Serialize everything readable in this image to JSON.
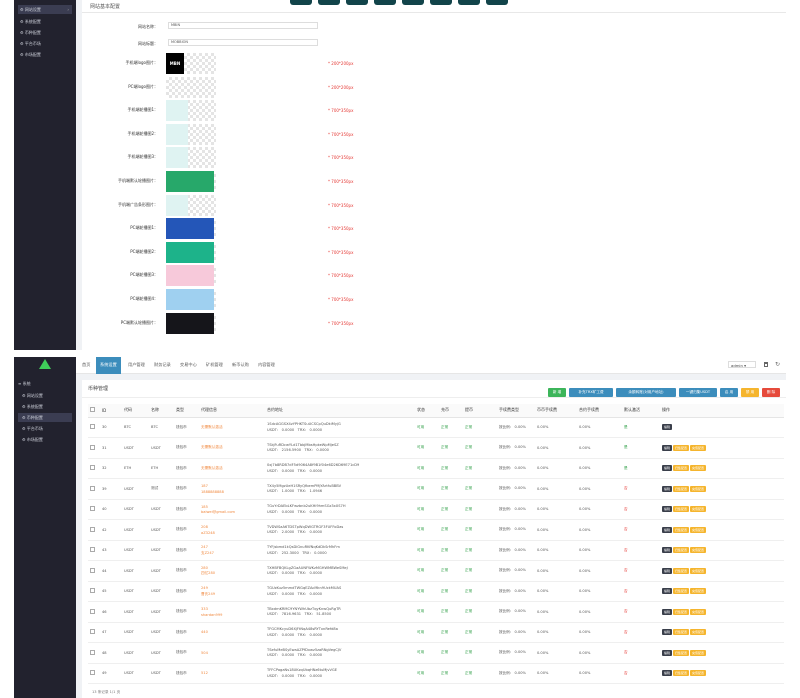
{
  "top_screen": {
    "sidebar": {
      "items": [
        {
          "label": "网站设置",
          "active": true
        },
        {
          "label": "系统配置"
        },
        {
          "label": "币种配置"
        },
        {
          "label": "平台币场"
        },
        {
          "label": "市场配置"
        }
      ]
    },
    "panel_title": "网站基本配置",
    "fields": [
      {
        "label": "网站名称：",
        "value": "MBIN"
      },
      {
        "label": "网站标题：",
        "value": "MOBBION"
      }
    ],
    "image_fields": [
      {
        "label": "手机端logo图片：",
        "hint": "* 200*200px",
        "thumb": "logo"
      },
      {
        "label": "PC端logo图片：",
        "hint": "* 200*200px",
        "thumb": "empty"
      },
      {
        "label": "手机端轮播图1：",
        "hint": "* 700*350px",
        "thumb": "banner-light"
      },
      {
        "label": "手机端轮播图2：",
        "hint": "* 700*350px",
        "thumb": "banner-light"
      },
      {
        "label": "手机端轮播图3：",
        "hint": "* 700*350px",
        "thumb": "banner-light"
      },
      {
        "label": "手机端默认轮播图片：",
        "hint": "* 700*350px",
        "thumb": "green"
      },
      {
        "label": "手机端广告条形图片：",
        "hint": "* 700*350px",
        "thumb": "banner-light"
      },
      {
        "label": "PC端轮播图1：",
        "hint": "* 700*350px",
        "thumb": "blue"
      },
      {
        "label": "PC端轮播图2：",
        "hint": "* 700*350px",
        "thumb": "teal"
      },
      {
        "label": "PC端轮播图3：",
        "hint": "* 700*350px",
        "thumb": "pink"
      },
      {
        "label": "PC端轮播图4：",
        "hint": "* 700*350px",
        "thumb": "lightblue"
      },
      {
        "label": "PC端默认轮播图片：",
        "hint": "* 700*350px",
        "thumb": "dark"
      }
    ],
    "logo_text": "MBN"
  },
  "bottom_screen": {
    "sidebar": {
      "section": "系统",
      "items": [
        {
          "label": "网站设置"
        },
        {
          "label": "系统配置"
        },
        {
          "label": "币种配置",
          "active": true
        },
        {
          "label": "平台币场"
        },
        {
          "label": "市场配置"
        }
      ]
    },
    "nav_tabs": [
      "首页",
      "系统设置",
      "用户管理",
      "财务记录",
      "交易中心",
      "矿机管理",
      "新币认购",
      "内容管理"
    ],
    "active_tab": 1,
    "admin_label": "admin ▾",
    "card_title": "币种管理",
    "buttons": [
      {
        "label": "新 增",
        "color": "#3cb55a"
      },
      {
        "label": "补充TRX矿工费",
        "color": "#3c8dbc"
      },
      {
        "label": "余额转账(对用户地址)",
        "color": "#3c8dbc"
      },
      {
        "label": "一键归集USDT",
        "color": "#3c8dbc"
      },
      {
        "label": "启 用",
        "color": "#3c8dbc"
      },
      {
        "label": "禁 用",
        "color": "#f5b52e"
      },
      {
        "label": "删 除",
        "color": "#e64a3b"
      }
    ],
    "table": {
      "headers": [
        "",
        "ID",
        "代码",
        "名称",
        "类型",
        "代理信息",
        "合约地址",
        "状态",
        "充币",
        "提币",
        "手续费类型",
        "",
        "币币手续费",
        "合约手续费",
        "默认激活",
        "操作"
      ],
      "rows": [
        {
          "id": "30",
          "code": "BTC",
          "name": "BTC",
          "type": "钱包币",
          "agent": "无需默认激活",
          "agent2": "",
          "addr": "1SdcAGGSX4zYPHKTSuUCSCpQuDkiMyjG",
          "usdt": "USDT： 0.0000",
          "trx": "TRX： 0.0000",
          "status": "可用",
          "deposit": "正常",
          "withdraw": "正常",
          "fee": "按比例： 0.00%",
          "coinfee": "0.00%",
          "contractfee": "0.00%",
          "default": "是",
          "default_color": "green",
          "actions": [
            "编辑"
          ]
        },
        {
          "id": "31",
          "code": "USDT",
          "name": "USDT",
          "type": "钱包币",
          "agent": "无需默认激活",
          "agent2": "",
          "addr": "TSkjFuRDcwYLd1TbbjMbsHpkeWpMjeSZ",
          "usdt": "USDT： 2156.5900",
          "trx": "TRX： 0.0000",
          "status": "可用",
          "deposit": "正常",
          "withdraw": "正常",
          "fee": "按比例： 0.00%",
          "coinfee": "0.00%",
          "contractfee": "0.00%",
          "default": "是",
          "default_color": "green",
          "actions": [
            "编辑",
            "归集配置",
            "充值配置"
          ]
        },
        {
          "id": "32",
          "code": "ETH",
          "name": "ETH",
          "type": "钱包币",
          "agent": "无需默认激活",
          "agent2": "",
          "addr": "0xj7b8RDB7dF5d9064A8f9B1f04e6D26D69E71cD9",
          "usdt": "USDT： 0.0000",
          "trx": "TRX： 0.0000",
          "status": "可用",
          "deposit": "正常",
          "withdraw": "正常",
          "fee": "按比例： 0.00%",
          "coinfee": "0.00%",
          "contractfee": "0.00%",
          "default": "是",
          "default_color": "green",
          "actions": [
            "编辑",
            "归集配置",
            "充值配置"
          ]
        },
        {
          "id": "39",
          "code": "USDT",
          "name": "测试",
          "type": "钱包币",
          "agent": "187",
          "agent2": "1888888888",
          "addr": "TX4y5MgzUeH1SRyQfbemPMjYArtfuBBBV",
          "usdt": "USDT： 1.0000",
          "trx": "TRX： 1.0946",
          "status": "可用",
          "deposit": "正常",
          "withdraw": "正常",
          "fee": "按比例： 0.00%",
          "coinfee": "0.00%",
          "contractfee": "0.00%",
          "default": "否",
          "default_color": "red",
          "actions": [
            "编辑",
            "归集配置",
            "充值配置"
          ]
        },
        {
          "id": "40",
          "code": "USDT",
          "name": "USDT",
          "type": "钱包币",
          "agent": "185",
          "agent2": "baiwei@gmail.com",
          "addr": "TGuYrDAEbLKFwzbnb2uKHi9hmSGz3xXS7H",
          "usdt": "USDT： 0.0000",
          "trx": "TRX： 0.0000",
          "status": "可用",
          "deposit": "正常",
          "withdraw": "正常",
          "fee": "按比例： 0.00%",
          "coinfee": "0.00%",
          "contractfee": "0.00%",
          "default": "否",
          "default_color": "red",
          "actions": [
            "编辑",
            "归集配置",
            "充值配置"
          ]
        },
        {
          "id": "42",
          "code": "USDT",
          "name": "USDT",
          "type": "钱包币",
          "agent": "208",
          "agent2": "aZ3248",
          "addr": "TVDWSaA6TDSTpWqDWGTRGF3FUFFoDas",
          "usdt": "USDT： 2.0000",
          "trx": "TRX： 0.0000",
          "status": "可用",
          "deposit": "正常",
          "withdraw": "正常",
          "fee": "按比例： 0.00%",
          "coinfee": "0.00%",
          "contractfee": "0.00%",
          "default": "否",
          "default_color": "red",
          "actions": [
            "编辑",
            "归集配置",
            "充值配置"
          ]
        },
        {
          "id": "43",
          "code": "USDT",
          "name": "USDT",
          "type": "钱包币",
          "agent": "247",
          "agent2": "支Z247",
          "addr": "TYFjsbmd1kQsDiGnuRKfNqKdDkSrMhFm",
          "usdt": "USDT： 252.3000",
          "trx": "TRX： 0.0000",
          "status": "可用",
          "deposit": "正常",
          "withdraw": "正常",
          "fee": "按比例： 0.00%",
          "coinfee": "0.00%",
          "contractfee": "0.00%",
          "default": "否",
          "default_color": "red",
          "actions": [
            "编辑",
            "归集配置",
            "充值配置"
          ]
        },
        {
          "id": "44",
          "code": "USDT",
          "name": "USDT",
          "type": "钱包币",
          "agent": "280",
          "agent2": "四亿280",
          "addr": "TXHBFBQKLgZGaAUNFWKzMGHWMBWeSMeJ",
          "usdt": "USDT： 0.0000",
          "trx": "TRX： 0.0000",
          "status": "可用",
          "deposit": "正常",
          "withdraw": "正常",
          "fee": "按比例： 0.00%",
          "coinfee": "0.00%",
          "contractfee": "0.00%",
          "default": "否",
          "default_color": "red",
          "actions": [
            "编辑",
            "归集配置",
            "充值配置"
          ]
        },
        {
          "id": "45",
          "code": "USDT",
          "name": "USDT",
          "type": "钱包币",
          "agent": "249",
          "agent2": "曹氏249",
          "addr": "TGUzKuz5mmdTWGqEZAcMkn9UckMUAS",
          "usdt": "USDT： 0.0000",
          "trx": "TRX： 0.0000",
          "status": "可用",
          "deposit": "正常",
          "withdraw": "正常",
          "fee": "按比例： 0.00%",
          "coinfee": "0.00%",
          "contractfee": "0.00%",
          "default": "否",
          "default_color": "red",
          "actions": [
            "编辑",
            "归集配置",
            "充值配置"
          ]
        },
        {
          "id": "46",
          "code": "USDT",
          "name": "USDT",
          "type": "钱包币",
          "agent": "333",
          "agent2": "shardan999",
          "addr": "TBxdmKRMC9YNYWhUbzTqyKnwQuRgTR",
          "usdt": "USDT： 7816.9631",
          "trx": "TRX： 51.8500",
          "status": "可用",
          "deposit": "正常",
          "withdraw": "正常",
          "fee": "按比例： 0.00%",
          "coinfee": "0.00%",
          "contractfee": "0.00%",
          "default": "否",
          "default_color": "red",
          "actions": [
            "编辑",
            "归集配置",
            "充值配置"
          ]
        },
        {
          "id": "47",
          "code": "USDT",
          "name": "USDT",
          "type": "钱包币",
          "agent": "440",
          "agent2": "",
          "addr": "TFGCMKcyuD6XjFtNqA48sRYTxnRefd8a",
          "usdt": "USDT： 0.0000",
          "trx": "TRX： 0.0000",
          "status": "可用",
          "deposit": "正常",
          "withdraw": "正常",
          "fee": "按比例： 0.00%",
          "coinfee": "0.00%",
          "contractfee": "0.00%",
          "default": "否",
          "default_color": "red",
          "actions": [
            "编辑",
            "归集配置",
            "充值配置"
          ]
        },
        {
          "id": "48",
          "code": "USDT",
          "name": "USDT",
          "type": "钱包币",
          "agent": "504",
          "agent2": "",
          "addr": "TSefuMeBSyEwaAZPfDxwz5zaRNgVegCJV",
          "usdt": "USDT： 0.0000",
          "trx": "TRX： 0.0000",
          "status": "可用",
          "deposit": "正常",
          "withdraw": "正常",
          "fee": "按比例： 0.00%",
          "coinfee": "0.00%",
          "contractfee": "0.00%",
          "default": "否",
          "default_color": "red",
          "actions": [
            "编辑",
            "归集配置",
            "充值配置"
          ]
        },
        {
          "id": "49",
          "code": "USDT",
          "name": "USDT",
          "type": "钱包币",
          "agent": "512",
          "agent2": "",
          "addr": "TFFCPagaNs18UKzqUbqHNz6tuMjvVGE",
          "usdt": "USDT： 0.0000",
          "trx": "TRX： 0.0000",
          "status": "可用",
          "deposit": "正常",
          "withdraw": "正常",
          "fee": "按比例： 0.00%",
          "coinfee": "0.00%",
          "contractfee": "0.00%",
          "default": "否",
          "default_color": "red",
          "actions": [
            "编辑",
            "归集配置",
            "充值配置"
          ]
        }
      ]
    },
    "footer": "13 条记录 1/1 页"
  }
}
